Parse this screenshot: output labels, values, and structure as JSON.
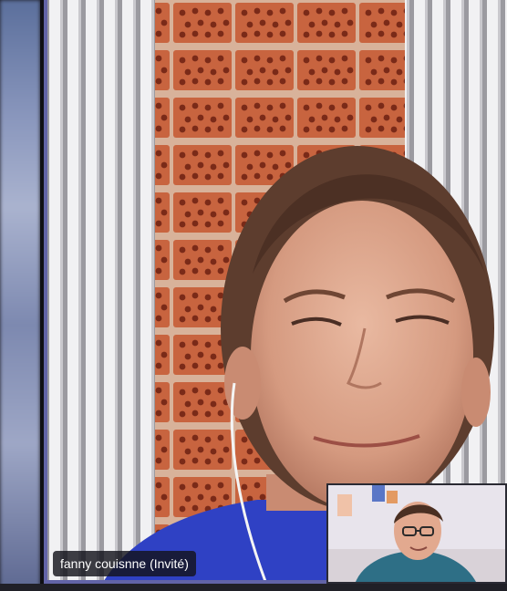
{
  "call": {
    "main_participant": {
      "name_label": "fanny couisnne (Invité)"
    }
  },
  "colors": {
    "active_speaker_border": "#6264a7",
    "name_tag_background": "#14141c",
    "stage_background": "#1b1b22"
  }
}
